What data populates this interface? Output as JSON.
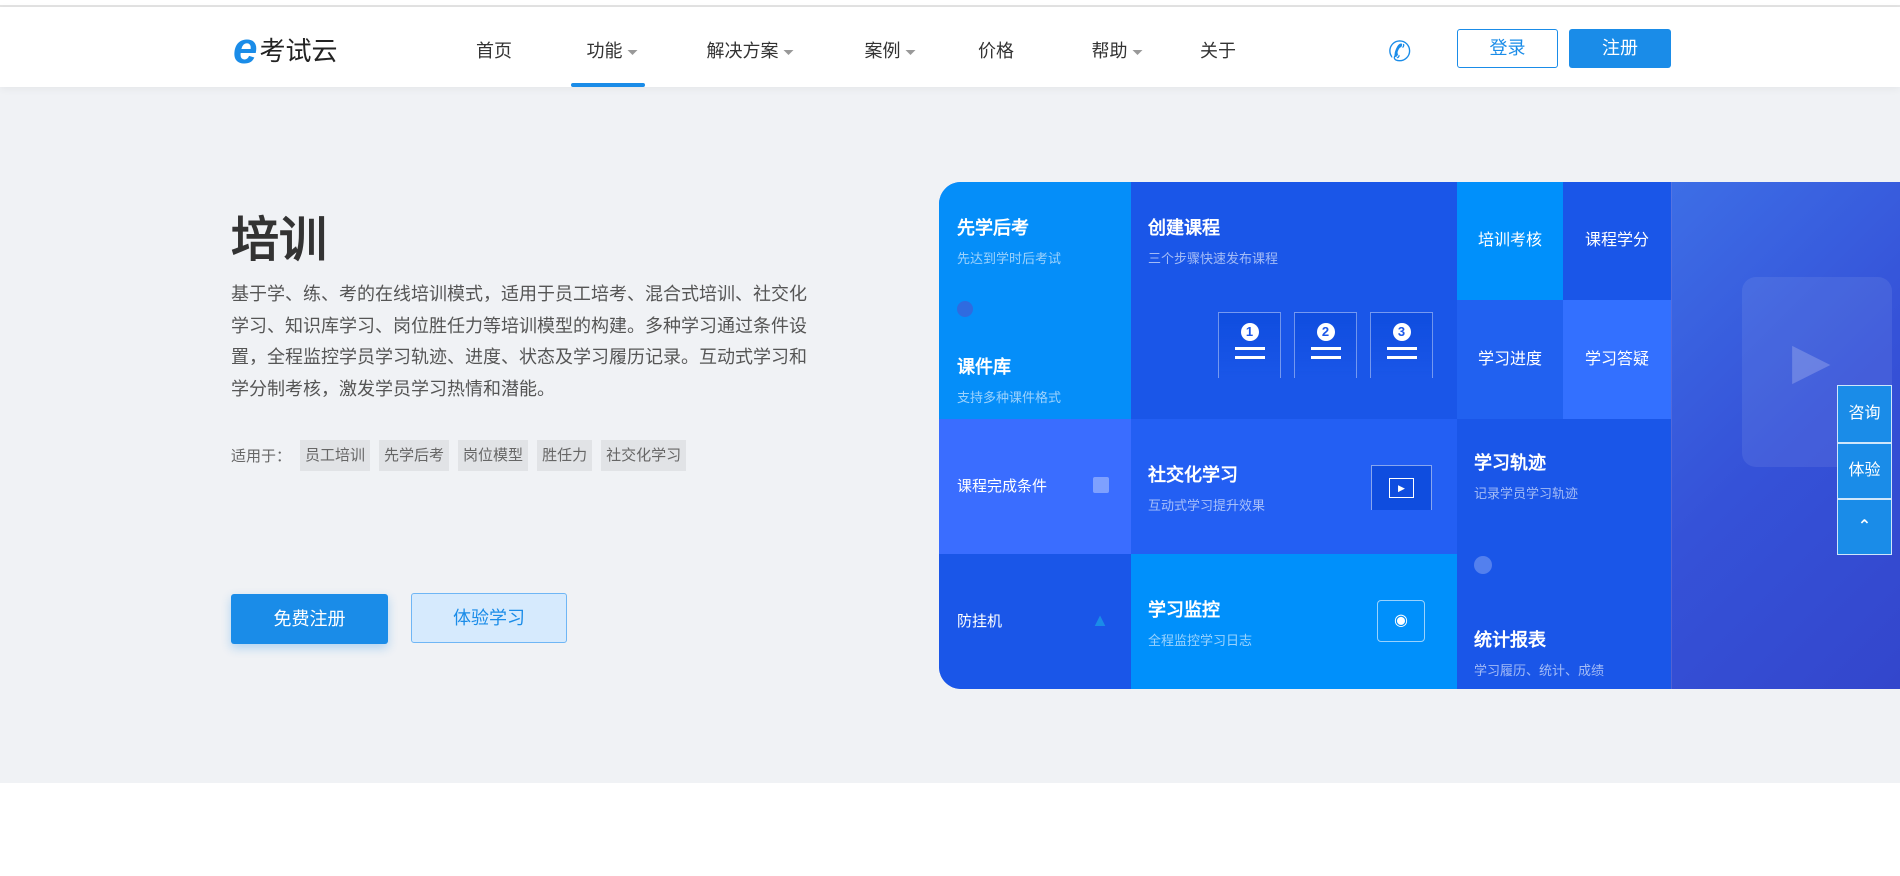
{
  "header": {
    "logo_mark": "e",
    "logo_text": "考试云",
    "nav": [
      {
        "label": "首页",
        "dropdown": false
      },
      {
        "label": "功能",
        "dropdown": true,
        "active": true
      },
      {
        "label": "解决方案",
        "dropdown": true
      },
      {
        "label": "案例",
        "dropdown": true
      },
      {
        "label": "价格",
        "dropdown": false
      },
      {
        "label": "帮助",
        "dropdown": true
      },
      {
        "label": "关于",
        "dropdown": false
      }
    ],
    "phone_icon": "phone-icon",
    "login": "登录",
    "register": "注册"
  },
  "hero": {
    "title": "培训",
    "description": "基于学、练、考的在线培训模式，适用于员工培考、混合式培训、社交化学习、知识库学习、岗位胜任力等培训模型的构建。多种学习通过条件设置，全程监控学员学习轨迹、进度、状态及学习履历记录。互动式学习和学分制考核，激发学员学习热情和潜能。",
    "apply_label": "适用于：",
    "tags": [
      "员工培训",
      "先学后考",
      "岗位模型",
      "胜任力",
      "社交化学习"
    ],
    "cta_primary": "免费注册",
    "cta_secondary": "体验学习"
  },
  "panel": {
    "xianxue": {
      "title": "先学后考",
      "sub": "先达到学时后考试"
    },
    "kejianku": {
      "title": "课件库",
      "sub": "支持多种课件格式"
    },
    "chuangjian": {
      "title": "创建课程",
      "sub": "三个步骤快速发布课程",
      "steps": [
        "1",
        "2",
        "3"
      ]
    },
    "peixun": "培训考核",
    "xuefen": "课程学分",
    "jindu": "学习进度",
    "dayi": "学习答疑",
    "wancheng": "课程完成条件",
    "shejiao": {
      "title": "社交化学习",
      "sub": "互动式学习提升效果"
    },
    "guiji": {
      "title": "学习轨迹",
      "sub": "记录学员学习轨迹"
    },
    "fangguaji": "防挂机",
    "jiankong": {
      "title": "学习监控",
      "sub": "全程监控学习日志"
    },
    "tongji": {
      "title": "统计报表",
      "sub": "学习履历、统计、成绩"
    }
  },
  "side": {
    "consult": "咨询",
    "trial": "体验",
    "top_icon": "chevron-up-icon"
  },
  "colors": {
    "accent": "#1a8ce8",
    "panel_dark": "#1a56e8",
    "panel_light": "#0090fb",
    "panel_mid": "#3a6dff"
  }
}
